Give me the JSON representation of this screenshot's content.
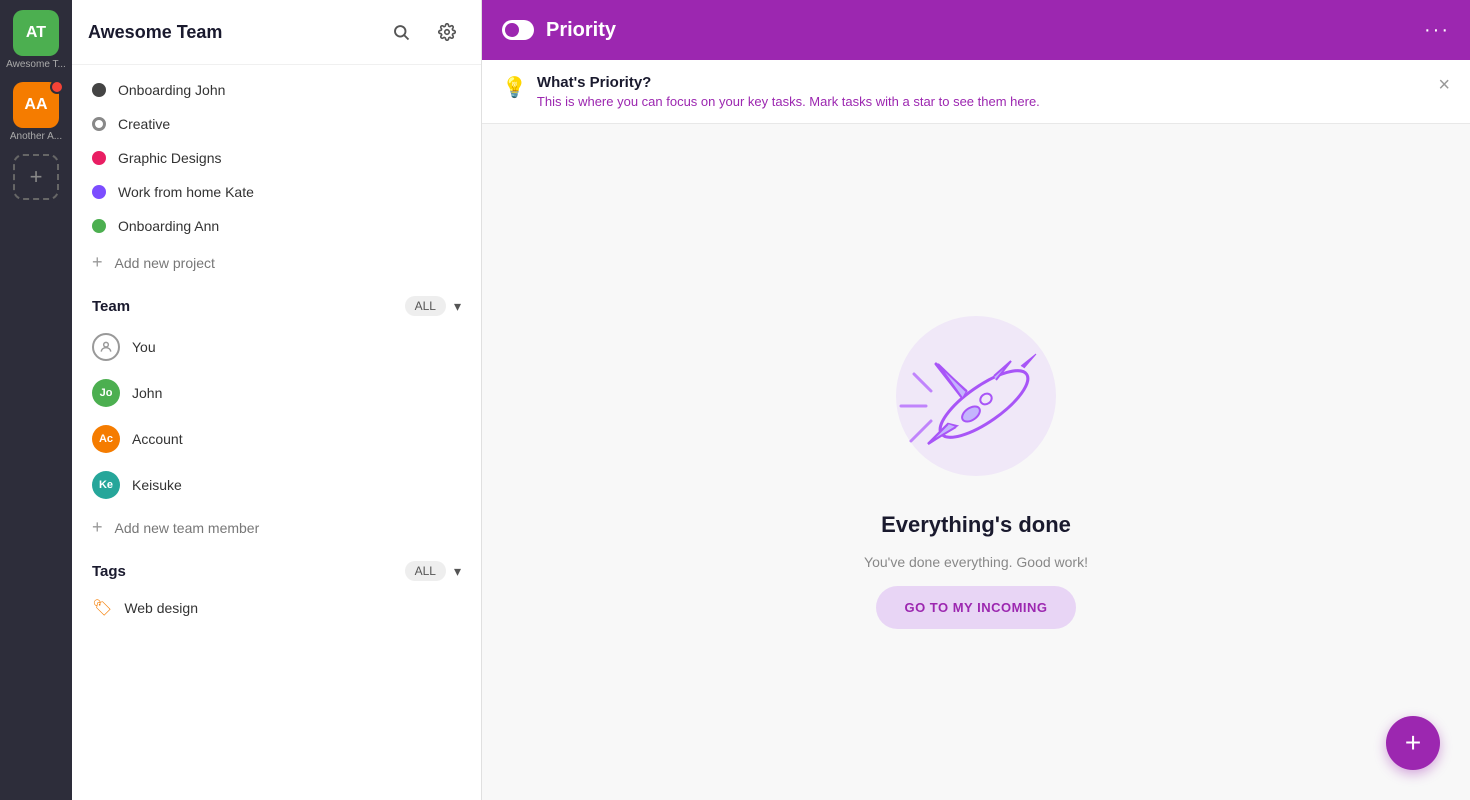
{
  "accountRail": {
    "accounts": [
      {
        "id": "at",
        "initials": "AT",
        "label": "Awesome T...",
        "color": "green",
        "active": true
      },
      {
        "id": "aa",
        "initials": "AA",
        "label": "Another A...",
        "color": "orange",
        "hasNotification": true
      }
    ],
    "addLabel": "+"
  },
  "sidebar": {
    "title": "Awesome Team",
    "searchTooltip": "Search",
    "settingsTooltip": "Settings",
    "projects": [
      {
        "id": "onboarding-john",
        "label": "Onboarding John",
        "dotClass": "dark"
      },
      {
        "id": "creative",
        "label": "Creative",
        "dotClass": "outline"
      },
      {
        "id": "graphic-designs",
        "label": "Graphic Designs",
        "dotClass": "pink"
      },
      {
        "id": "work-from-home-kate",
        "label": "Work from home Kate",
        "dotClass": "purple"
      },
      {
        "id": "onboarding-ann",
        "label": "Onboarding Ann",
        "dotClass": "green"
      }
    ],
    "addProjectLabel": "Add new project",
    "teamSection": {
      "title": "Team",
      "filterLabel": "ALL",
      "members": [
        {
          "id": "you",
          "label": "You",
          "avatarClass": "gray-outline",
          "initials": ""
        },
        {
          "id": "john",
          "label": "John",
          "avatarClass": "green",
          "initials": "Jo"
        },
        {
          "id": "account",
          "label": "Account",
          "avatarClass": "orange",
          "initials": "Ac"
        },
        {
          "id": "keisuke",
          "label": "Keisuke",
          "avatarClass": "teal",
          "initials": "Ke"
        }
      ],
      "addMemberLabel": "Add new team member"
    },
    "tagsSection": {
      "title": "Tags",
      "filterLabel": "ALL",
      "tags": [
        {
          "id": "web-design",
          "label": "Web design"
        }
      ]
    }
  },
  "topbar": {
    "title": "Priority",
    "moreLabel": "···"
  },
  "infoBanner": {
    "icon": "💡",
    "title": "What's Priority?",
    "description": "This is where you can focus on your key tasks. Mark tasks with a star to see them here."
  },
  "emptyState": {
    "title": "Everything's done",
    "description": "You've done everything. Good work!",
    "buttonLabel": "GO TO MY INCOMING"
  },
  "fab": {
    "label": "+"
  },
  "colors": {
    "purple": "#9c27b0",
    "purpleLight": "#e8d5f5"
  }
}
